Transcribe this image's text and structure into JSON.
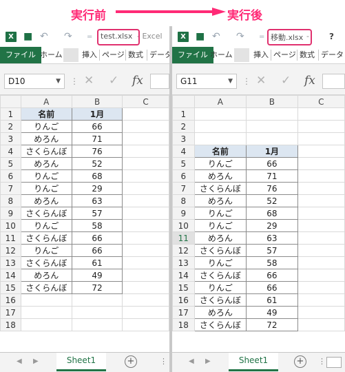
{
  "banner": {
    "before": "実行前",
    "after": "実行後"
  },
  "colors": {
    "accent": "#ff2a76",
    "excel_green": "#217346",
    "header_fill": "#dce6f1"
  },
  "left": {
    "filename": "test.xlsx",
    "app": "- Excel",
    "ribbon_tabs": [
      "ファイル",
      "ホーム",
      "挿入",
      "ページ",
      "数式",
      "データ"
    ],
    "name_box": "D10",
    "columns": [
      "A",
      "B",
      "C"
    ],
    "row_numbers": [
      1,
      2,
      3,
      4,
      5,
      6,
      7,
      8,
      9,
      10,
      11,
      12,
      13,
      14,
      15,
      16,
      17,
      18
    ],
    "sheet_tab": "Sheet1"
  },
  "right": {
    "filename": "移動.xlsx",
    "app": "-",
    "help": "?",
    "ribbon_tabs": [
      "ファイル",
      "ホーム",
      "挿入",
      "ページ",
      "数式",
      "データ"
    ],
    "name_box": "G11",
    "columns": [
      "A",
      "B",
      "C"
    ],
    "row_numbers": [
      1,
      2,
      3,
      4,
      5,
      6,
      7,
      8,
      9,
      10,
      11,
      12,
      13,
      14,
      15,
      16,
      17,
      18
    ],
    "sheet_tab": "Sheet1"
  },
  "table": {
    "headers": [
      "名前",
      "1月"
    ],
    "rows": [
      [
        "りんご",
        "66"
      ],
      [
        "めろん",
        "71"
      ],
      [
        "さくらんぼ",
        "76"
      ],
      [
        "めろん",
        "52"
      ],
      [
        "りんご",
        "68"
      ],
      [
        "りんご",
        "29"
      ],
      [
        "めろん",
        "63"
      ],
      [
        "さくらんぼ",
        "57"
      ],
      [
        "りんご",
        "58"
      ],
      [
        "さくらんぼ",
        "66"
      ],
      [
        "りんご",
        "66"
      ],
      [
        "さくらんぼ",
        "61"
      ],
      [
        "めろん",
        "49"
      ],
      [
        "さくらんぼ",
        "72"
      ]
    ]
  }
}
